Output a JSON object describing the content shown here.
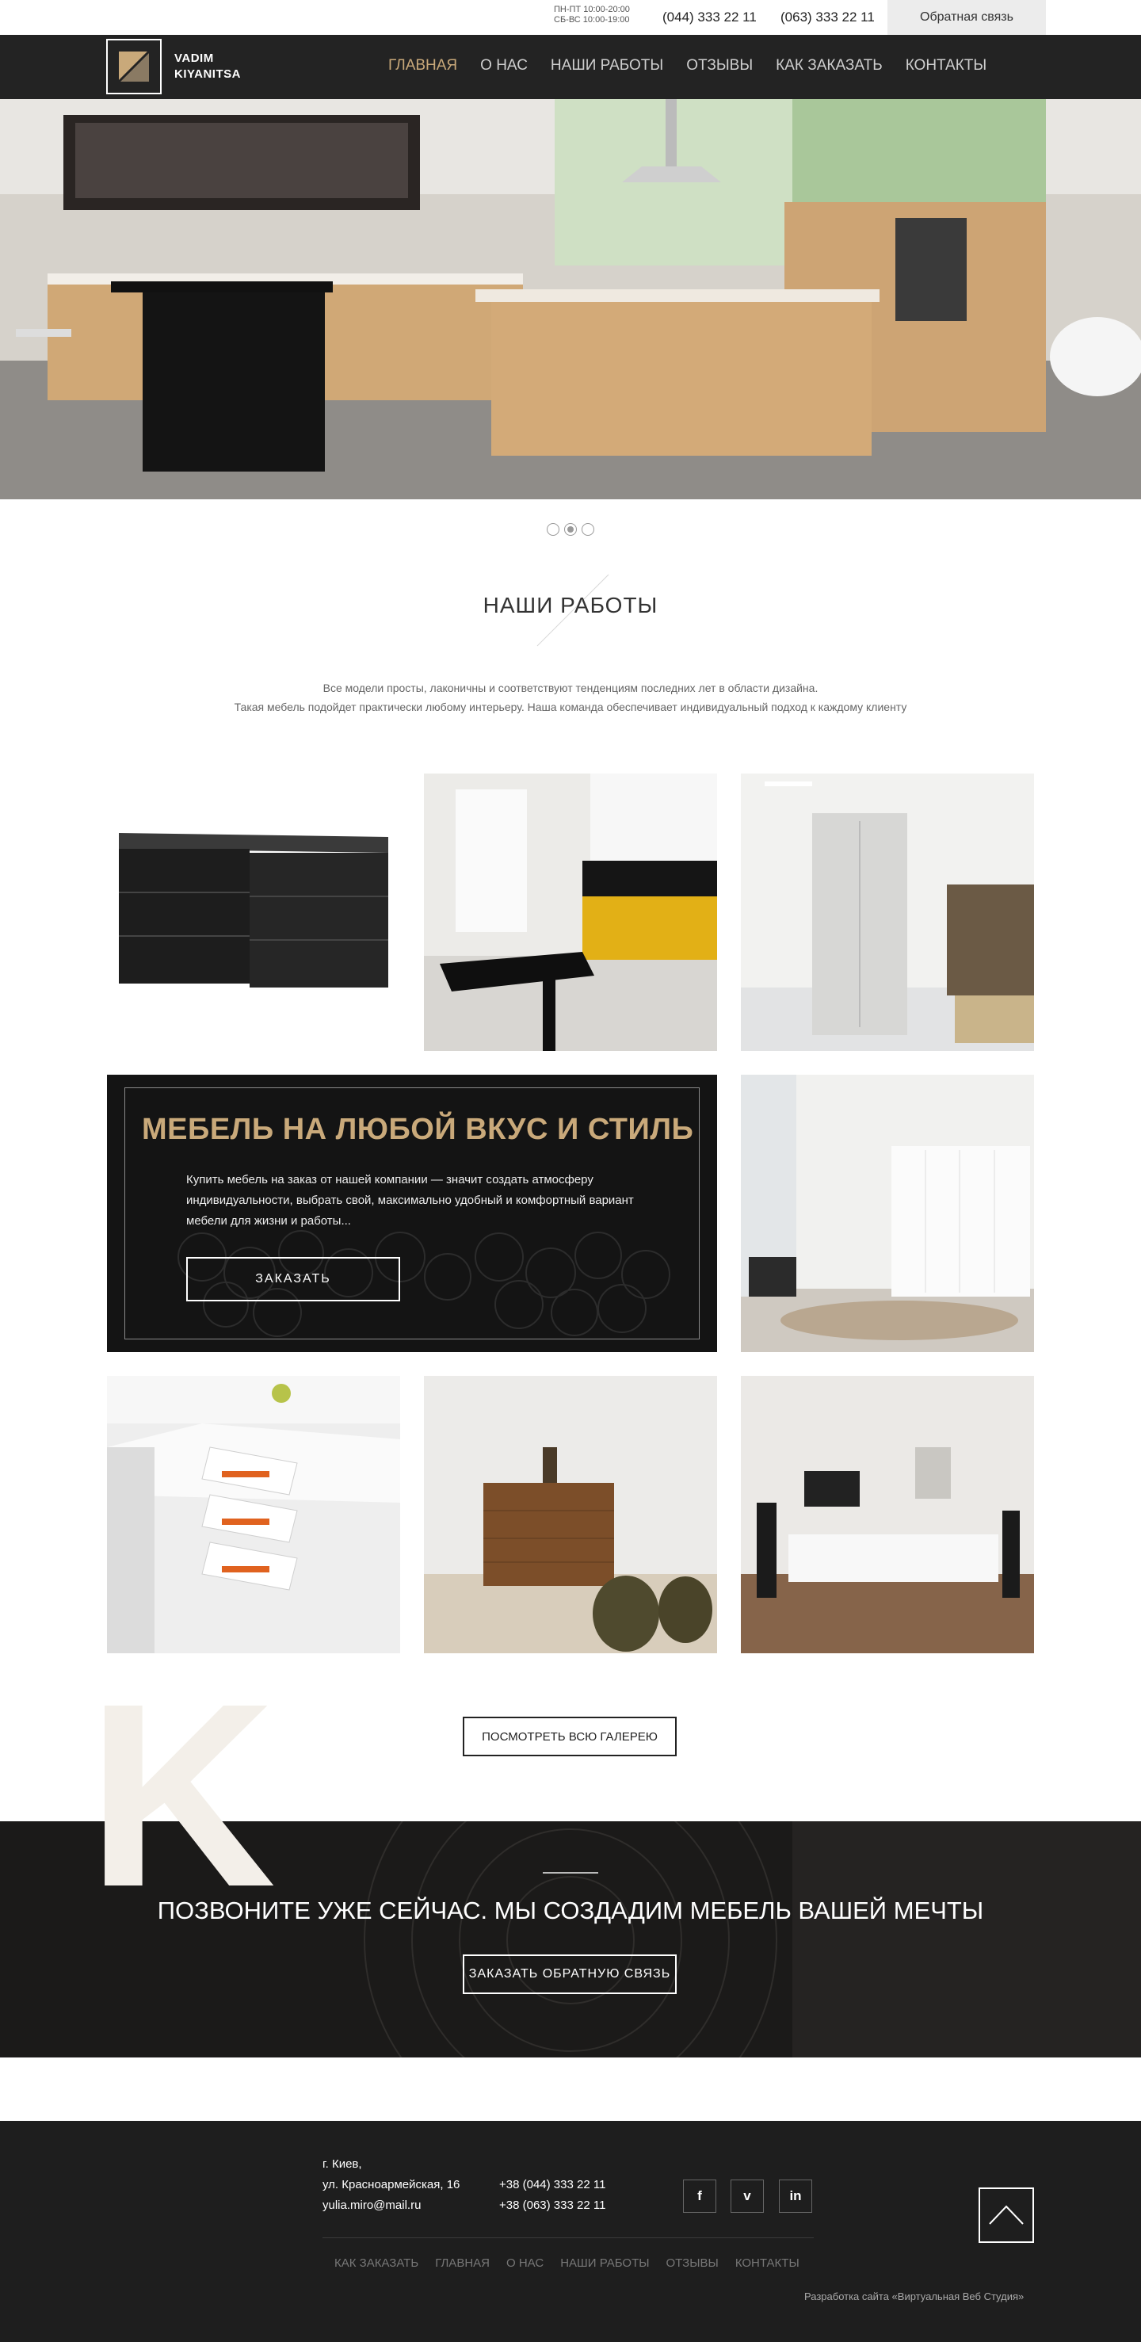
{
  "topbar": {
    "hours_weekdays": "ПН-ПТ 10:00-20:00",
    "hours_weekend": "СБ-ВС 10:00-19:00",
    "phone1": "(044) 333 22 11",
    "phone2": "(063) 333 22 11",
    "callback_label": "Обратная связь"
  },
  "brand": {
    "line1": "VADIM",
    "line2": "KIYANITSA"
  },
  "nav": {
    "items": [
      "ГЛАВНАЯ",
      "О НАС",
      "НАШИ РАБОТЫ",
      "ОТЗЫВЫ",
      "КАК ЗАКАЗАТЬ",
      "КОНТАКТЫ"
    ],
    "active_index": 0
  },
  "slider": {
    "count": 3,
    "active_index": 1
  },
  "works": {
    "title": "НАШИ РАБОТЫ",
    "desc_line1": "Все модели просты, лаконичны и соответствуют тенденциям последних лет в области дизайна.",
    "desc_line2": "Такая мебель подойдет практически любому интерьеру. Наша команда обеспечивает индивидуальный подход к каждому клиенту"
  },
  "promo": {
    "title": "МЕБЕЛЬ НА ЛЮБОЙ ВКУС И СТИЛЬ",
    "text": "Купить мебель на заказ от нашей компании  — значит создать атмосферу индивидуальности, выбрать свой, максимально удобный и комфортный вариант мебели для жизни и работы...",
    "button": "ЗАКАЗАТЬ"
  },
  "gallery_button": "ПОСМОТРЕТЬ ВСЮ ГАЛЕРЕЮ",
  "decor_letter": "K",
  "cta": {
    "title": "ПОЗВОНИТЕ УЖЕ СЕЙЧАС. МЫ СОЗДАДИМ МЕБЕЛЬ ВАШЕЙ МЕЧТЫ",
    "button": "ЗАКАЗАТЬ ОБРАТНУЮ СВЯЗЬ"
  },
  "footer": {
    "city": "г. Киев,",
    "street": "ул. Красноармейская, 16",
    "email": "yulia.miro@mail.ru",
    "phone1": "+38 (044) 333 22 11",
    "phone2": "+38 (063) 333 22 11",
    "social": {
      "facebook": "f",
      "vimeo": "v",
      "linkedin": "in"
    },
    "nav": [
      "КАК ЗАКАЗАТЬ",
      "ГЛАВНАЯ",
      "О НАС",
      "НАШИ РАБОТЫ",
      "ОТЗЫВЫ",
      "КОНТАКТЫ"
    ],
    "credit": "Разработка сайта «Виртуальная Веб Студия»"
  },
  "colors": {
    "accent": "#c9a97a",
    "dark": "#232323",
    "footer": "#1e1e1e"
  }
}
